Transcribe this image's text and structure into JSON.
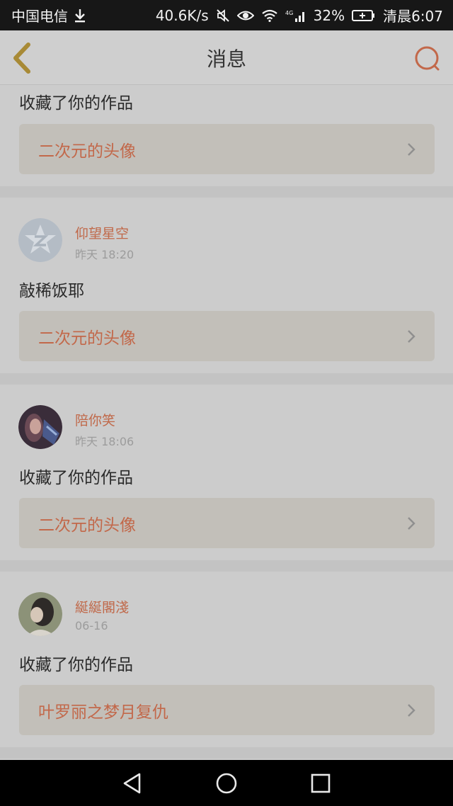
{
  "status_bar": {
    "carrier": "中国电信",
    "speed": "40.6K/s",
    "network": "4G",
    "battery": "32%",
    "time": "清晨6:07"
  },
  "header": {
    "title": "消息"
  },
  "messages": [
    {
      "action": "收藏了你的作品",
      "work": "二次元的头像"
    },
    {
      "user": "仰望星空",
      "time": "昨天 18:20",
      "action": "敲稀饭耶",
      "work": "二次元的头像"
    },
    {
      "user": "陪你笑",
      "time": "昨天 18:06",
      "action": "收藏了你的作品",
      "work": "二次元的头像"
    },
    {
      "user": "綖綖閣淺",
      "time": "06-16",
      "action": "收藏了你的作品",
      "work": "叶罗丽之梦月复仇"
    }
  ],
  "colors": {
    "accent": "#c2684a",
    "status_bar": "#171717",
    "nav_bar": "#000000"
  }
}
